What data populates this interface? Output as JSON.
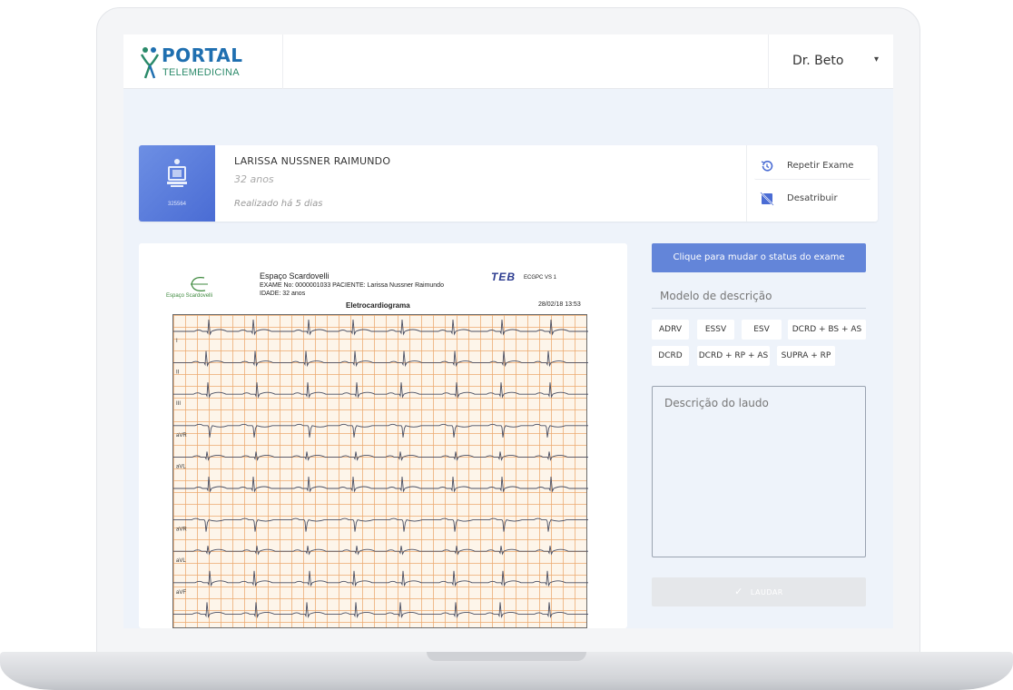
{
  "app": {
    "logo_title": "PORTAL",
    "logo_subtitle": "TELEMEDICINA",
    "user_name": "Dr. Beto",
    "user_caret": "▾"
  },
  "patient": {
    "name": "LARISSA NUSSNER RAIMUNDO",
    "age": "32 anos",
    "performed": "Realizado há 5 dias",
    "thumb_id": "325564"
  },
  "actions": {
    "repeat_label": "Repetir Exame",
    "unassign_label": "Desatribuir"
  },
  "ecg": {
    "clinic_logo_text": "Espaço Scardovelli",
    "clinic_name": "Espaço Scardovelli",
    "exam_line": "EXAME No: 0000001033  PACIENTE: Larissa Nussner Raimundo",
    "age_line": "IDADE: 32 anos",
    "title": "Eletrocardiograma",
    "date": "28/02/18 13:53",
    "device_logo": "TEB",
    "device_model": "ECGPC VS 1",
    "leads": [
      "I",
      "II",
      "III",
      "aVR",
      "aVL",
      "",
      "aVR",
      "aVL",
      "aVF",
      ""
    ]
  },
  "status_button": "Clique para mudar o status do exame",
  "description_model_label": "Modelo de descrição",
  "tags": [
    "ADRV",
    "ESSV",
    "ESV",
    "DCRD + BS + AS",
    "DCRD",
    "DCRD + RP + AS",
    "SUPRA + RP"
  ],
  "description_placeholder": "Descrição do laudo",
  "laudar_label": "LAUDAR",
  "colors": {
    "primary": "#6385d9",
    "thumb": "#5a7cdc",
    "ecg_grid": "#ecaa6e",
    "brand_blue": "#1f6fb0",
    "brand_green": "#2b8a6a"
  }
}
